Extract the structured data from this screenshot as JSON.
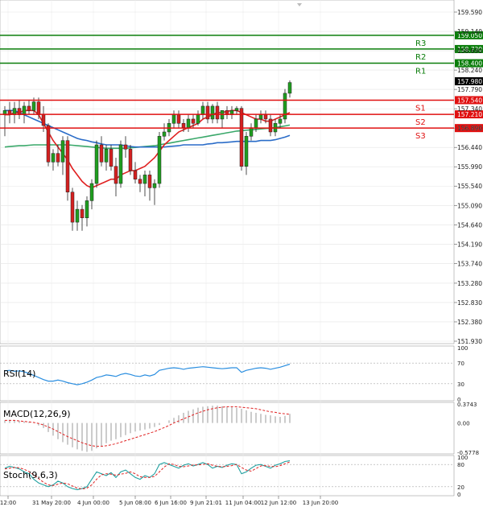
{
  "price_axis": {
    "ticks": [
      "159.590",
      "159.140",
      "158.690",
      "158.240",
      "157.790",
      "157.340",
      "156.890",
      "156.440",
      "155.990",
      "155.540",
      "155.090",
      "154.640",
      "154.190",
      "153.740",
      "153.280",
      "152.830",
      "152.380",
      "151.930"
    ],
    "range": [
      151.93,
      159.59
    ]
  },
  "time_axis": {
    "labels": [
      "12:00",
      "31 May 20:00",
      "4 Jun 00:00",
      "5 Jun 08:00",
      "6 Jun 16:00",
      "9 Jun 21:01",
      "11 Jun 04:00",
      "12 Jun 12:00",
      "13 Jun 20:00"
    ]
  },
  "levels": [
    {
      "name": "R3",
      "value": 159.05,
      "label": "159.050",
      "color": "#0a7d0a"
    },
    {
      "name": "R2",
      "value": 158.73,
      "label": "158.730",
      "color": "#0a7d0a"
    },
    {
      "name": "R1",
      "value": 158.4,
      "label": "158.400",
      "color": "#0a7d0a"
    },
    {
      "name": "S1",
      "value": 157.54,
      "label": "157.540",
      "color": "#e01010"
    },
    {
      "name": "S2",
      "value": 157.21,
      "label": "157.210",
      "color": "#e01010"
    },
    {
      "name": "S3",
      "value": 156.89,
      "label": "156.890",
      "color": "#e01010"
    }
  ],
  "current_price": {
    "label": "157.980",
    "value": 157.98
  },
  "indicators": {
    "rsi": {
      "label": "RSI(14)",
      "ticks": [
        "100",
        "70",
        "30",
        "0"
      ]
    },
    "macd": {
      "label": "MACD(12,26,9)",
      "ticks": [
        "0.3743",
        "0.00",
        "-0.5778"
      ]
    },
    "stoch": {
      "label": "Stoch(9,6,3)",
      "ticks": [
        "100",
        "80",
        "20",
        "0"
      ]
    }
  },
  "colors": {
    "bull": "#1f9e1f",
    "bear": "#d42020",
    "ma_fast": "#e02020",
    "ma_mid": "#2a6cc8",
    "ma_slow": "#3aa86a",
    "rsi": "#2a8ee0",
    "stoch_main": "#20a0a0",
    "stoch_signal": "#e02020",
    "macd_signal": "#e02020",
    "macd_hist": "#999999"
  },
  "chart_data": {
    "type": "candlestick",
    "y_range": [
      151.93,
      159.59
    ],
    "candles": [
      {
        "o": 157.2,
        "h": 157.4,
        "l": 156.7,
        "c": 157.3
      },
      {
        "o": 157.3,
        "h": 157.5,
        "l": 157.0,
        "c": 157.2
      },
      {
        "o": 157.2,
        "h": 157.5,
        "l": 157.0,
        "c": 157.35
      },
      {
        "o": 157.35,
        "h": 157.55,
        "l": 157.1,
        "c": 157.2
      },
      {
        "o": 157.2,
        "h": 157.5,
        "l": 157.0,
        "c": 157.4
      },
      {
        "o": 157.4,
        "h": 157.55,
        "l": 157.2,
        "c": 157.3
      },
      {
        "o": 157.3,
        "h": 157.6,
        "l": 157.2,
        "c": 157.5
      },
      {
        "o": 157.5,
        "h": 157.6,
        "l": 157.1,
        "c": 157.2
      },
      {
        "o": 157.2,
        "h": 157.4,
        "l": 156.8,
        "c": 156.95
      },
      {
        "o": 156.95,
        "h": 157.0,
        "l": 156.0,
        "c": 156.1
      },
      {
        "o": 156.1,
        "h": 156.4,
        "l": 155.9,
        "c": 156.3
      },
      {
        "o": 156.3,
        "h": 156.5,
        "l": 156.0,
        "c": 156.1
      },
      {
        "o": 156.1,
        "h": 156.7,
        "l": 155.8,
        "c": 156.6
      },
      {
        "o": 156.6,
        "h": 156.7,
        "l": 155.2,
        "c": 155.4
      },
      {
        "o": 155.4,
        "h": 155.5,
        "l": 154.5,
        "c": 154.7
      },
      {
        "o": 154.7,
        "h": 155.2,
        "l": 154.5,
        "c": 155.0
      },
      {
        "o": 155.0,
        "h": 155.1,
        "l": 154.5,
        "c": 154.8
      },
      {
        "o": 154.8,
        "h": 155.3,
        "l": 154.6,
        "c": 155.2
      },
      {
        "o": 155.2,
        "h": 155.7,
        "l": 155.0,
        "c": 155.6
      },
      {
        "o": 155.6,
        "h": 156.6,
        "l": 155.5,
        "c": 156.5
      },
      {
        "o": 156.5,
        "h": 156.7,
        "l": 156.0,
        "c": 156.1
      },
      {
        "o": 156.1,
        "h": 156.5,
        "l": 155.9,
        "c": 156.4
      },
      {
        "o": 156.4,
        "h": 156.5,
        "l": 155.9,
        "c": 156.0
      },
      {
        "o": 156.0,
        "h": 156.2,
        "l": 155.3,
        "c": 155.6
      },
      {
        "o": 155.6,
        "h": 156.6,
        "l": 155.5,
        "c": 156.5
      },
      {
        "o": 156.5,
        "h": 156.7,
        "l": 156.2,
        "c": 156.4
      },
      {
        "o": 156.4,
        "h": 156.5,
        "l": 155.8,
        "c": 155.9
      },
      {
        "o": 155.9,
        "h": 156.1,
        "l": 155.6,
        "c": 155.7
      },
      {
        "o": 155.7,
        "h": 155.8,
        "l": 155.4,
        "c": 155.6
      },
      {
        "o": 155.6,
        "h": 155.9,
        "l": 155.3,
        "c": 155.8
      },
      {
        "o": 155.8,
        "h": 155.9,
        "l": 155.2,
        "c": 155.5
      },
      {
        "o": 155.5,
        "h": 155.7,
        "l": 155.1,
        "c": 155.6
      },
      {
        "o": 155.6,
        "h": 156.8,
        "l": 155.5,
        "c": 156.7
      },
      {
        "o": 156.7,
        "h": 157.0,
        "l": 156.6,
        "c": 156.8
      },
      {
        "o": 156.8,
        "h": 157.1,
        "l": 156.7,
        "c": 157.0
      },
      {
        "o": 157.0,
        "h": 157.3,
        "l": 156.9,
        "c": 157.2
      },
      {
        "o": 157.2,
        "h": 157.3,
        "l": 156.9,
        "c": 157.0
      },
      {
        "o": 157.0,
        "h": 157.1,
        "l": 156.8,
        "c": 156.9
      },
      {
        "o": 156.9,
        "h": 157.2,
        "l": 156.8,
        "c": 157.1
      },
      {
        "o": 157.1,
        "h": 157.2,
        "l": 156.9,
        "c": 157.0
      },
      {
        "o": 157.0,
        "h": 157.3,
        "l": 156.95,
        "c": 157.2
      },
      {
        "o": 157.2,
        "h": 157.5,
        "l": 157.1,
        "c": 157.4
      },
      {
        "o": 157.4,
        "h": 157.5,
        "l": 157.0,
        "c": 157.1
      },
      {
        "o": 157.1,
        "h": 157.45,
        "l": 157.0,
        "c": 157.4
      },
      {
        "o": 157.4,
        "h": 157.5,
        "l": 157.0,
        "c": 157.1
      },
      {
        "o": 157.1,
        "h": 157.3,
        "l": 156.9,
        "c": 157.3
      },
      {
        "o": 157.3,
        "h": 157.4,
        "l": 157.1,
        "c": 157.2
      },
      {
        "o": 157.2,
        "h": 157.4,
        "l": 157.1,
        "c": 157.3
      },
      {
        "o": 157.3,
        "h": 157.4,
        "l": 157.2,
        "c": 157.35
      },
      {
        "o": 157.35,
        "h": 157.4,
        "l": 155.9,
        "c": 156.0
      },
      {
        "o": 156.0,
        "h": 156.8,
        "l": 155.8,
        "c": 156.7
      },
      {
        "o": 156.7,
        "h": 157.0,
        "l": 156.6,
        "c": 156.9
      },
      {
        "o": 156.9,
        "h": 157.2,
        "l": 156.8,
        "c": 157.1
      },
      {
        "o": 157.1,
        "h": 157.3,
        "l": 157.0,
        "c": 157.2
      },
      {
        "o": 157.2,
        "h": 157.3,
        "l": 157.0,
        "c": 157.1
      },
      {
        "o": 157.1,
        "h": 157.2,
        "l": 156.7,
        "c": 156.8
      },
      {
        "o": 156.8,
        "h": 157.1,
        "l": 156.7,
        "c": 157.0
      },
      {
        "o": 157.0,
        "h": 157.2,
        "l": 156.9,
        "c": 157.1
      },
      {
        "o": 157.1,
        "h": 157.8,
        "l": 157.0,
        "c": 157.7
      },
      {
        "o": 157.7,
        "h": 158.0,
        "l": 157.6,
        "c": 157.95
      }
    ],
    "ma_fast": [
      157.2,
      157.2,
      157.25,
      157.25,
      157.3,
      157.3,
      157.3,
      157.2,
      157.0,
      156.8,
      156.6,
      156.45,
      156.3,
      156.15,
      155.95,
      155.8,
      155.65,
      155.55,
      155.5,
      155.55,
      155.6,
      155.65,
      155.7,
      155.7,
      155.8,
      155.85,
      155.9,
      155.9,
      155.95,
      156.0,
      156.1,
      156.2,
      156.35,
      156.5,
      156.6,
      156.7,
      156.8,
      156.85,
      156.9,
      156.95,
      157.0,
      157.1,
      157.15,
      157.2,
      157.25,
      157.25,
      157.28,
      157.3,
      157.3,
      157.25,
      157.2,
      157.15,
      157.1,
      157.1,
      157.05,
      157.05,
      157.1,
      157.15,
      157.2,
      157.25
    ],
    "ma_mid": [
      157.3,
      157.3,
      157.3,
      157.25,
      157.2,
      157.15,
      157.1,
      157.05,
      157.0,
      156.95,
      156.9,
      156.85,
      156.8,
      156.75,
      156.7,
      156.65,
      156.62,
      156.6,
      156.57,
      156.55,
      156.52,
      156.5,
      156.5,
      156.5,
      156.5,
      156.48,
      156.46,
      156.45,
      156.45,
      156.45,
      156.45,
      156.45,
      156.45,
      156.45,
      156.46,
      156.47,
      156.48,
      156.5,
      156.5,
      156.5,
      156.5,
      156.5,
      156.52,
      156.53,
      156.55,
      156.55,
      156.56,
      156.57,
      156.58,
      156.58,
      156.58,
      156.58,
      156.58,
      156.6,
      156.6,
      156.6,
      156.62,
      156.65,
      156.68,
      156.72
    ],
    "ma_slow": [
      156.45,
      156.46,
      156.47,
      156.48,
      156.48,
      156.49,
      156.5,
      156.5,
      156.5,
      156.5,
      156.5,
      156.5,
      156.5,
      156.5,
      156.49,
      156.48,
      156.47,
      156.46,
      156.45,
      156.44,
      156.43,
      156.42,
      156.42,
      156.42,
      156.42,
      156.42,
      156.43,
      156.44,
      156.45,
      156.46,
      156.47,
      156.48,
      156.5,
      156.52,
      156.54,
      156.56,
      156.58,
      156.6,
      156.62,
      156.64,
      156.66,
      156.68,
      156.7,
      156.72,
      156.74,
      156.76,
      156.78,
      156.8,
      156.82,
      156.83,
      156.84,
      156.85,
      156.86,
      156.87,
      156.88,
      156.89,
      156.9,
      156.92,
      156.94,
      156.96
    ],
    "rsi": [
      55,
      56,
      54,
      55,
      53,
      50,
      46,
      42,
      38,
      35,
      35,
      37,
      35,
      32,
      30,
      28,
      30,
      33,
      37,
      42,
      44,
      47,
      46,
      44,
      48,
      50,
      48,
      45,
      44,
      47,
      45,
      48,
      56,
      58,
      60,
      61,
      60,
      58,
      60,
      61,
      62,
      63,
      62,
      61,
      60,
      59,
      60,
      61,
      61,
      52,
      56,
      58,
      60,
      61,
      60,
      58,
      60,
      62,
      65,
      68
    ],
    "macd_hist": [
      0.05,
      0.06,
      0.05,
      0.04,
      0.03,
      0.02,
      0.0,
      -0.05,
      -0.1,
      -0.18,
      -0.25,
      -0.32,
      -0.38,
      -0.43,
      -0.48,
      -0.52,
      -0.55,
      -0.57,
      -0.55,
      -0.5,
      -0.45,
      -0.4,
      -0.35,
      -0.32,
      -0.28,
      -0.24,
      -0.2,
      -0.17,
      -0.15,
      -0.13,
      -0.11,
      -0.08,
      -0.04,
      0.0,
      0.05,
      0.1,
      0.15,
      0.2,
      0.24,
      0.27,
      0.3,
      0.32,
      0.33,
      0.34,
      0.34,
      0.33,
      0.32,
      0.31,
      0.3,
      0.28,
      0.25,
      0.22,
      0.2,
      0.18,
      0.16,
      0.15,
      0.13,
      0.12,
      0.14,
      0.18
    ],
    "macd_signal": [
      0.05,
      0.05,
      0.05,
      0.04,
      0.03,
      0.02,
      0.01,
      -0.01,
      -0.04,
      -0.08,
      -0.12,
      -0.17,
      -0.22,
      -0.27,
      -0.31,
      -0.35,
      -0.39,
      -0.42,
      -0.45,
      -0.46,
      -0.46,
      -0.45,
      -0.43,
      -0.41,
      -0.38,
      -0.35,
      -0.32,
      -0.29,
      -0.26,
      -0.23,
      -0.2,
      -0.17,
      -0.13,
      -0.09,
      -0.05,
      0.0,
      0.04,
      0.08,
      0.12,
      0.16,
      0.2,
      0.23,
      0.26,
      0.28,
      0.3,
      0.31,
      0.32,
      0.32,
      0.32,
      0.31,
      0.3,
      0.29,
      0.28,
      0.26,
      0.24,
      0.22,
      0.21,
      0.19,
      0.18,
      0.17
    ],
    "stoch_main": [
      70,
      75,
      72,
      68,
      60,
      55,
      40,
      30,
      25,
      20,
      25,
      35,
      30,
      20,
      15,
      12,
      15,
      20,
      40,
      60,
      55,
      50,
      58,
      45,
      60,
      65,
      55,
      45,
      40,
      50,
      45,
      55,
      80,
      85,
      80,
      75,
      70,
      78,
      82,
      76,
      80,
      85,
      80,
      70,
      75,
      72,
      78,
      82,
      80,
      55,
      60,
      70,
      78,
      80,
      75,
      70,
      78,
      82,
      88,
      90
    ],
    "stoch_signal": [
      68,
      70,
      72,
      71,
      67,
      61,
      52,
      42,
      32,
      25,
      23,
      27,
      30,
      28,
      22,
      16,
      14,
      16,
      25,
      40,
      52,
      55,
      54,
      51,
      54,
      56,
      60,
      55,
      47,
      45,
      45,
      48,
      60,
      73,
      82,
      80,
      75,
      74,
      76,
      79,
      79,
      80,
      82,
      78,
      75,
      74,
      75,
      77,
      80,
      72,
      65,
      62,
      69,
      76,
      77,
      75,
      74,
      77,
      82,
      87
    ]
  }
}
